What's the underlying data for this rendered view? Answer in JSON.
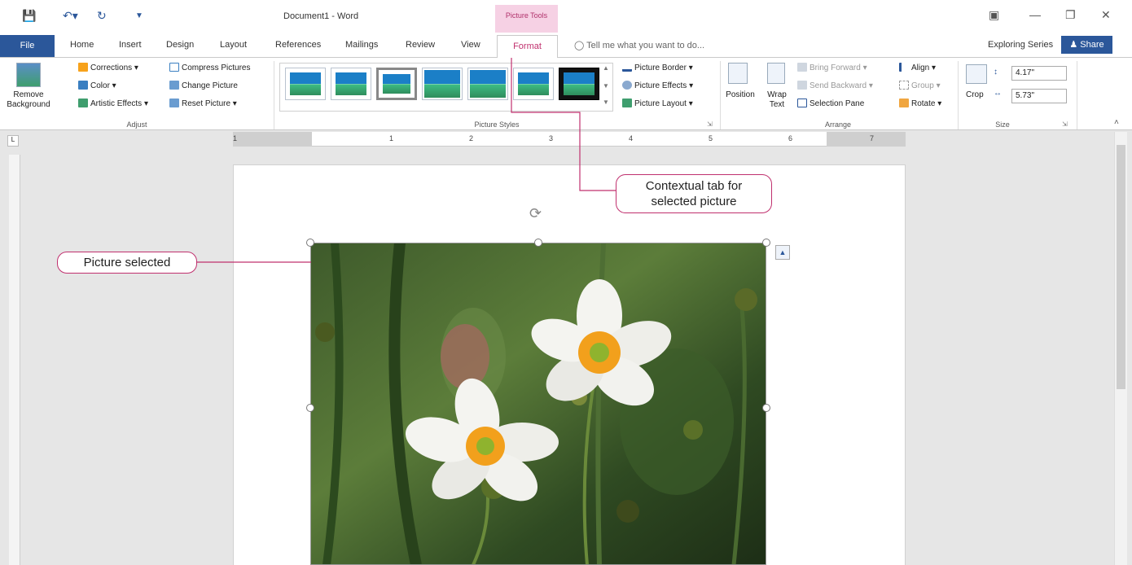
{
  "window": {
    "title": "Document1 - Word",
    "contextual_group": "Picture Tools"
  },
  "tabs": [
    {
      "label": "File"
    },
    {
      "label": "Home"
    },
    {
      "label": "Insert"
    },
    {
      "label": "Design"
    },
    {
      "label": "Layout"
    },
    {
      "label": "References"
    },
    {
      "label": "Mailings"
    },
    {
      "label": "Review"
    },
    {
      "label": "View"
    },
    {
      "label": "Format"
    }
  ],
  "tell_me": "Tell me what you want to do...",
  "account": "Exploring Series",
  "share": "Share",
  "ribbon": {
    "adjust": {
      "label": "Adjust",
      "remove_background": "Remove Background",
      "corrections": "Corrections",
      "color": "Color",
      "artistic_effects": "Artistic Effects",
      "compress": "Compress Pictures",
      "change": "Change Picture",
      "reset": "Reset Picture"
    },
    "styles": {
      "label": "Picture Styles",
      "border": "Picture Border",
      "effects": "Picture Effects",
      "layout": "Picture Layout"
    },
    "arrange": {
      "label": "Arrange",
      "position": "Position",
      "wrap_text": "Wrap Text",
      "bring_forward": "Bring Forward",
      "send_backward": "Send Backward",
      "selection_pane": "Selection Pane",
      "align": "Align",
      "group": "Group",
      "rotate": "Rotate"
    },
    "size": {
      "label": "Size",
      "crop": "Crop",
      "height": "4.17\"",
      "width": "5.73\""
    }
  },
  "ruler_numbers": [
    "1",
    "1",
    "2",
    "3",
    "4",
    "5",
    "6",
    "7"
  ],
  "callouts": {
    "contextual": "Contextual tab for selected picture",
    "picture": "Picture selected"
  },
  "colors": {
    "accent": "#2b579a",
    "contextual": "#c0306e",
    "callout_line": "#c0306e"
  }
}
